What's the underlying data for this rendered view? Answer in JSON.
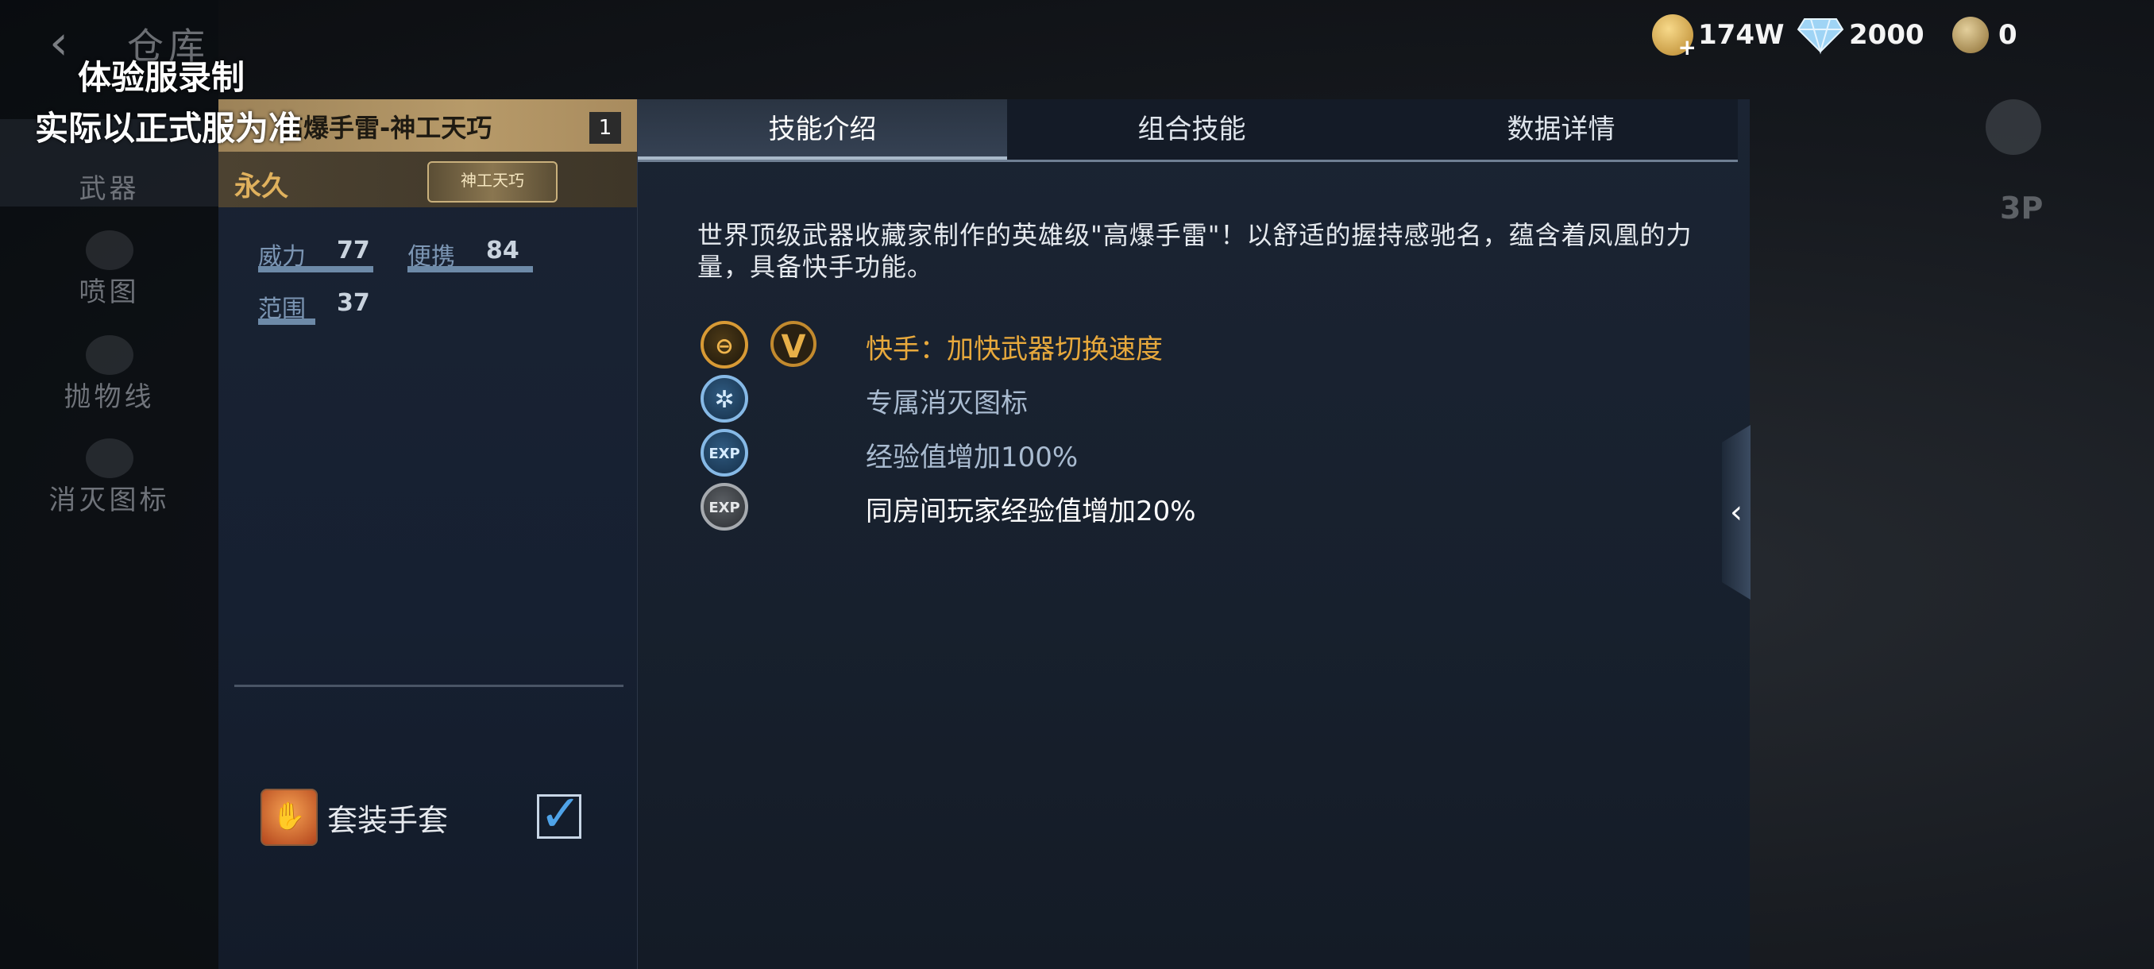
{
  "background": {
    "title": "仓库",
    "nav_items": [
      "武器",
      "喷图",
      "抛物线",
      "消灭图标"
    ],
    "view_mode": "3P"
  },
  "watermark": {
    "line1": "体验服录制",
    "line2": "实际以正式服为准"
  },
  "currencies": [
    {
      "icon": "gold-coin-icon",
      "value": "174W"
    },
    {
      "icon": "diamond-icon",
      "value": "2000"
    },
    {
      "icon": "medal-icon",
      "value": "0"
    }
  ],
  "item": {
    "name": "高爆手雷-神工天巧",
    "count": "1",
    "duration": "永久",
    "badge": "神工天巧",
    "stats": [
      {
        "label": "威力",
        "value": "77"
      },
      {
        "label": "便携",
        "value": "84"
      },
      {
        "label": "范围",
        "value": "37"
      }
    ],
    "suit": {
      "label": "套装手套",
      "checked": true
    }
  },
  "tabs": [
    "技能介绍",
    "组合技能",
    "数据详情"
  ],
  "active_tab": 0,
  "description": "世界顶级武器收藏家制作的英雄级\"高爆手雷\"！以舒适的握持感驰名，蕴含着凤凰的力量，具备快手功能。",
  "skills": [
    {
      "icon": "quick-hand-icon",
      "badge": "V",
      "text": "快手：加快武器切换速度",
      "color": "#e8a93c"
    },
    {
      "icon": "kill-icon",
      "text": "专属消灭图标",
      "color": "#a9bbd0"
    },
    {
      "icon": "exp-icon",
      "text": "经验值增加100%",
      "color": "#a9bbd0"
    },
    {
      "icon": "room-exp-icon",
      "text": "同房间玩家经验值增加20%",
      "color": "#ffffff"
    }
  ],
  "colors": {
    "accent_gold": "#e8a93c",
    "header_gold": "#b79a69",
    "stat_blue": "#7c96b4"
  }
}
